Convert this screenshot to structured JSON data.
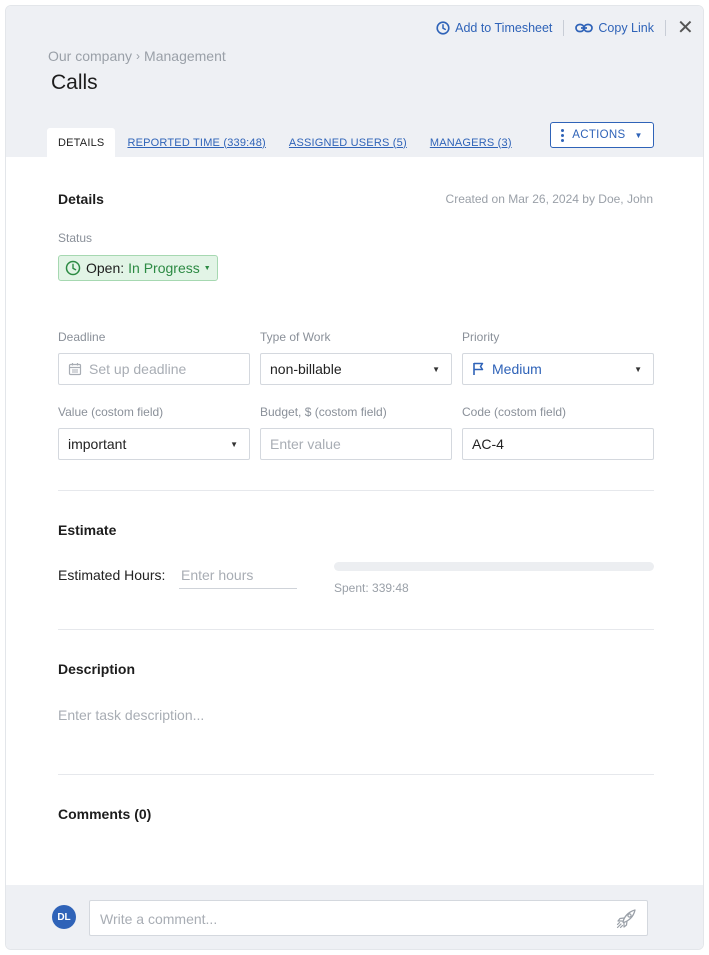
{
  "header": {
    "add_to_timesheet": "Add to Timesheet",
    "copy_link": "Copy Link",
    "close": "✕",
    "breadcrumb": [
      "Our company",
      "Management"
    ],
    "breadcrumb_sep": "›",
    "title": "Calls"
  },
  "tabs": [
    {
      "label": "DETAILS",
      "active": true
    },
    {
      "label": "REPORTED TIME (339:48)"
    },
    {
      "label": "ASSIGNED USERS (5)"
    },
    {
      "label": "MANAGERS (3)"
    }
  ],
  "actions_label": "ACTIONS",
  "details": {
    "title": "Details",
    "created": "Created on Mar 26, 2024 by Doe, John",
    "status_label": "Status",
    "status_prefix": "Open:",
    "status_value": "In Progress",
    "deadline_label": "Deadline",
    "deadline_placeholder": "Set up deadline",
    "type_label": "Type of Work",
    "type_value": "non-billable",
    "priority_label": "Priority",
    "priority_value": "Medium",
    "value_label": "Value (costom field)",
    "value_value": "important",
    "budget_label": "Budget, $ (costom field)",
    "budget_placeholder": "Enter value",
    "code_label": "Code (costom field)",
    "code_value": "AC-4"
  },
  "estimate": {
    "title": "Estimate",
    "hours_label": "Estimated Hours:",
    "hours_placeholder": "Enter hours",
    "spent": "Spent: 339:48",
    "progress_fraction": 0
  },
  "description": {
    "title": "Description",
    "placeholder": "Enter task description..."
  },
  "comments": {
    "title": "Comments (0)",
    "avatar_initials": "DL",
    "placeholder": "Write a comment..."
  },
  "colors": {
    "accent": "#2f63b8",
    "status_green": "#2c8a43",
    "header_bg": "#eef0f4"
  },
  "icons": [
    "clock-icon",
    "link-icon",
    "close-icon",
    "calendar-icon",
    "flag-icon",
    "rocket-icon",
    "kebab-icon"
  ]
}
